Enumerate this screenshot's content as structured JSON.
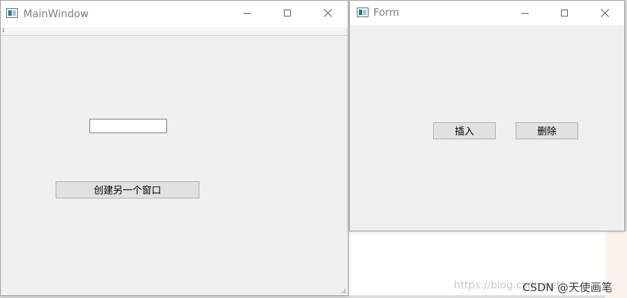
{
  "main_window": {
    "title": "MainWindow",
    "input_value": "",
    "create_button_label": "创建另一个窗口"
  },
  "form_window": {
    "title": "Form",
    "insert_label": "插入",
    "delete_label": "删除"
  },
  "overlay": {
    "watermark": "https://blog.csdn.net/",
    "credit": "CSDN @天使画笔"
  },
  "icons": {
    "app": "qt-window-icon",
    "minimize": "minimize-icon",
    "maximize": "maximize-icon",
    "close": "close-icon"
  }
}
